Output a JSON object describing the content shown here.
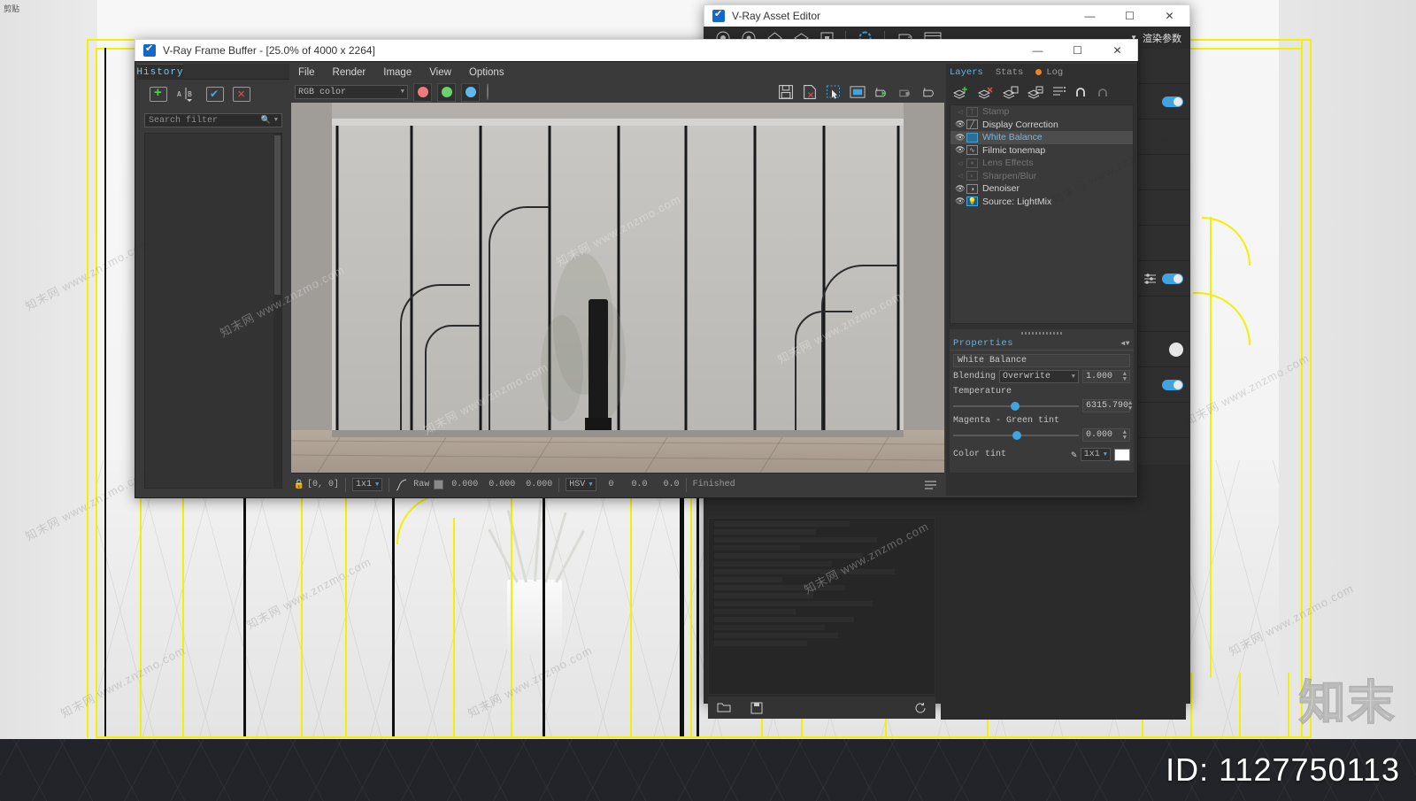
{
  "page": {
    "corner_note": "剪贴",
    "watermark_text": "知末网 www.znzmo.com",
    "watermark_logo": "知末",
    "id_label": "ID: 1127750113"
  },
  "vfb": {
    "title": "V-Ray Frame Buffer - [25.0% of 4000 x 2264]",
    "window_buttons": {
      "minimize": "—",
      "maximize": "☐",
      "close": "✕"
    },
    "history": {
      "tab_label": "History",
      "tools": [
        "add-history-icon",
        "compare-ab-icon",
        "check-history-icon",
        "delete-history-icon"
      ],
      "search_placeholder": "Search filter",
      "search_icon": "search-icon",
      "dropdown_icon": "chevron-down-icon"
    },
    "menu": [
      "File",
      "Render",
      "Image",
      "View",
      "Options"
    ],
    "channel_select": "RGB color",
    "channel_toggles": [
      "red-channel",
      "green-channel",
      "blue-channel",
      "alpha-channel"
    ],
    "right_tools": [
      "save-image-icon",
      "save-image-as-icon",
      "region-render-icon",
      "fit-view-icon",
      "start-render-icon",
      "stop-render-icon",
      "vray-render-icon"
    ],
    "statusbar": {
      "lock_icon": "lock-icon",
      "coords": "[0, 0]",
      "pixel_sampler": "1x1",
      "curve_icon": "curve-icon",
      "raw_label": "Raw",
      "raw_values": [
        "0.000",
        "0.000",
        "0.000"
      ],
      "color_mode": "HSV",
      "hsv_values": [
        "0",
        "0.0",
        "0.0"
      ],
      "render_state": "Finished",
      "menu_icon": "list-icon"
    },
    "layers_panel": {
      "tabs": [
        {
          "label": "Layers",
          "active": true
        },
        {
          "label": "Stats",
          "active": false
        },
        {
          "label": "Log",
          "active": false,
          "dot": true
        }
      ],
      "tools": [
        "add-layer-icon",
        "delete-layer-icon",
        "save-layers-icon",
        "load-layers-icon",
        "layer-presets-icon",
        "undo-icon",
        "redo-icon"
      ],
      "layers": [
        {
          "name": "Stamp",
          "visible": false,
          "icon": "stamp-icon",
          "selected": false
        },
        {
          "name": "Display Correction",
          "visible": true,
          "icon": "curve-icon",
          "selected": false
        },
        {
          "name": "White Balance",
          "visible": true,
          "icon": "wb-icon",
          "selected": true
        },
        {
          "name": "Filmic tonemap",
          "visible": true,
          "icon": "filmic-icon",
          "selected": false
        },
        {
          "name": "Lens Effects",
          "visible": false,
          "icon": "lens-icon",
          "selected": false
        },
        {
          "name": "Sharpen/Blur",
          "visible": false,
          "icon": "sharpen-icon",
          "selected": false
        },
        {
          "name": "Denoiser",
          "visible": true,
          "icon": "denoise-icon",
          "selected": false
        },
        {
          "name": "Source: LightMix",
          "visible": true,
          "icon": "lightmix-icon",
          "selected": false
        }
      ]
    },
    "properties": {
      "header": "Properties",
      "layer_name": "White Balance",
      "blending_label": "Blending",
      "blending_value": "Overwrite",
      "blending_amount": "1.000",
      "temperature_label": "Temperature",
      "temperature_value": "6315.790",
      "temperature_pct": 44,
      "magenta_green_label": "Magenta - Green tint",
      "magenta_green_value": "0.000",
      "magenta_green_pct": 50,
      "color_tint_label": "Color tint",
      "color_tint_picker": "eyedropper-icon",
      "color_tint_size": "1x1",
      "color_tint_swatch": "#ffffff"
    }
  },
  "asset_editor": {
    "title": "V-Ray Asset Editor",
    "window_buttons": {
      "minimize": "—",
      "maximize": "☐",
      "close": "✕"
    },
    "toolbar_icons": [
      "materials-icon",
      "lights-icon",
      "geometry-icon",
      "textures-icon",
      "render-elements-icon",
      "settings-icon",
      "teapot-icon",
      "frame-buffer-icon"
    ],
    "toolbar_dropdown_label": "渲染参数",
    "toolbar_dropdown_icon": "chevron-down-icon",
    "strip_toggles": [
      {
        "state": "on"
      },
      {
        "state": "off"
      },
      {
        "state": "off"
      },
      {
        "state": "off"
      },
      {
        "state": "off"
      },
      {
        "state": "on"
      },
      {
        "state": "off"
      },
      {
        "state": "knob"
      },
      {
        "state": "on"
      }
    ],
    "log_bar_icons": [
      "open-folder-icon",
      "save-icon",
      "reset-icon"
    ],
    "hscroll": {
      "left_arrow": "◀",
      "right_arrow": "▶"
    }
  },
  "colors": {
    "accent_blue": "#3fa4e0",
    "tab_blue": "#5fb4e8",
    "guide_yellow": "#f4f000",
    "panel_dark": "#3a3a3a",
    "window_dark": "#2b2b2b"
  }
}
